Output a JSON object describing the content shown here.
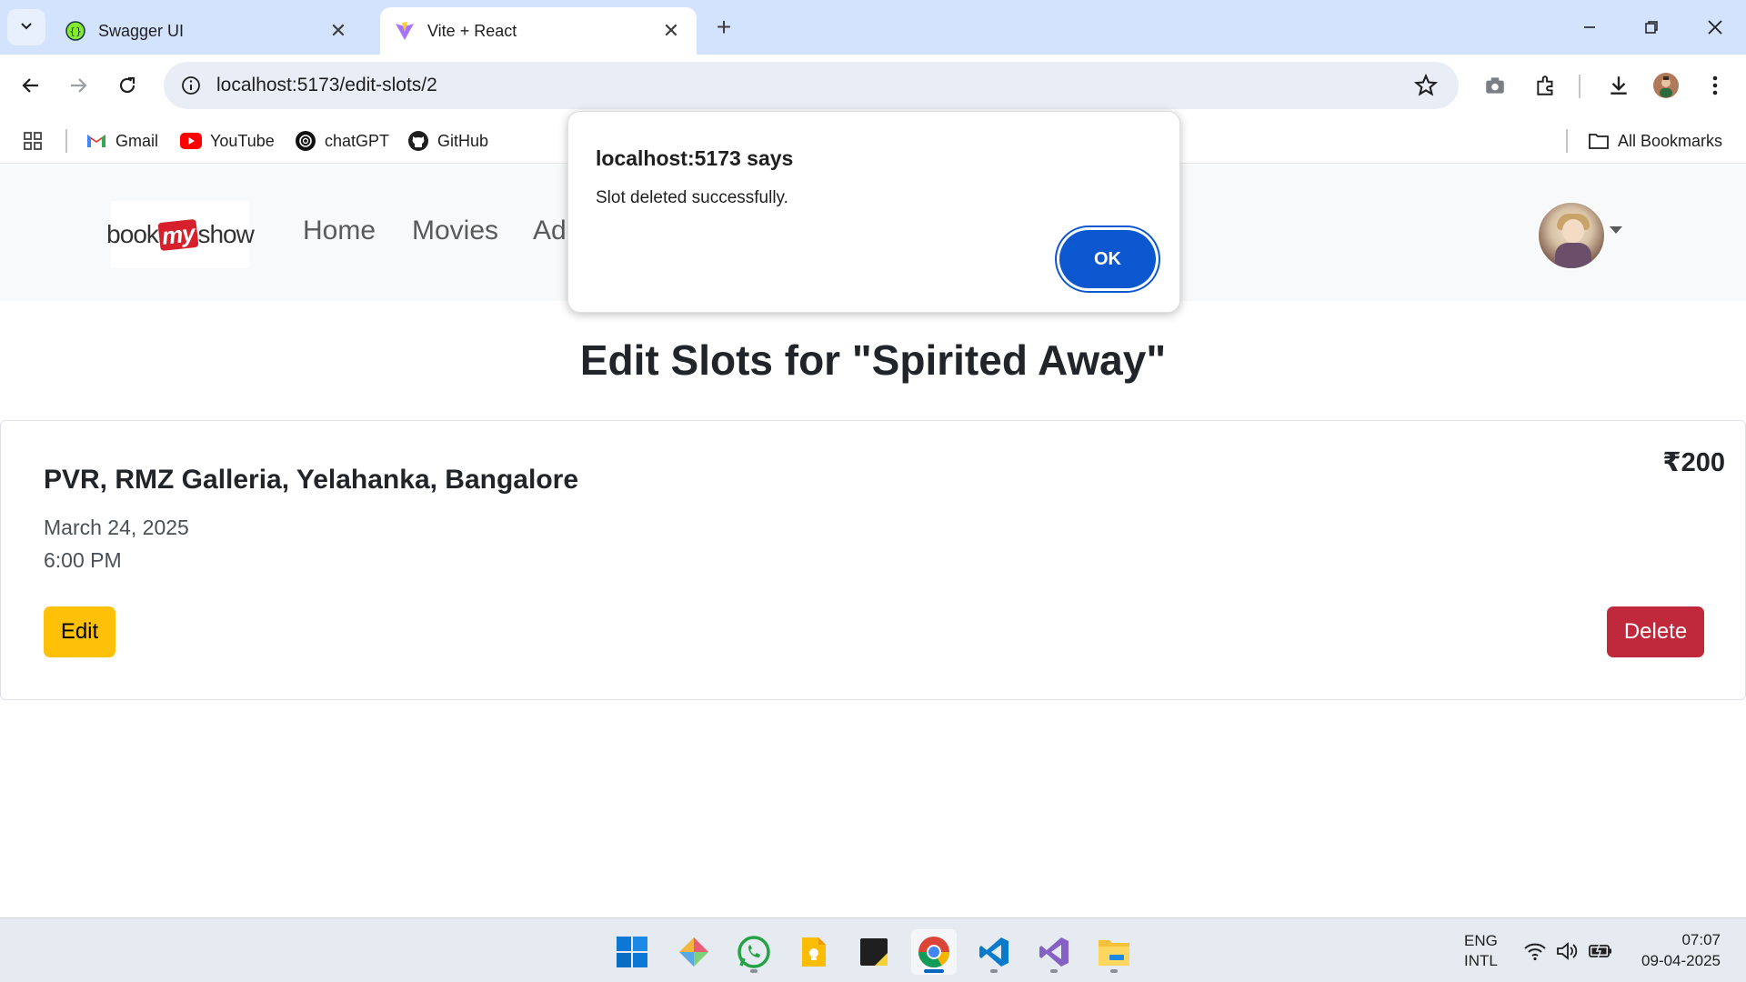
{
  "browser": {
    "tabs": [
      {
        "title": "Swagger UI",
        "icon": "swagger-icon"
      },
      {
        "title": "Vite + React",
        "icon": "vite-icon"
      }
    ],
    "url": "localhost:5173/edit-slots/2",
    "bookmarks": [
      {
        "label": "Gmail",
        "icon": "gmail-icon"
      },
      {
        "label": "YouTube",
        "icon": "youtube-icon"
      },
      {
        "label": "chatGPT",
        "icon": "chatgpt-icon"
      },
      {
        "label": "GitHub",
        "icon": "github-icon"
      }
    ],
    "all_bookmarks": "All Bookmarks"
  },
  "app": {
    "logo": {
      "pre": "book",
      "mid": "my",
      "post": "show"
    },
    "nav": [
      {
        "label": "Home"
      },
      {
        "label": "Movies"
      },
      {
        "label": "Ad"
      }
    ],
    "page_title": "Edit Slots for \"Spirited Away\"",
    "slot": {
      "theatre": "PVR, RMZ Galleria, Yelahanka, Bangalore",
      "price": "₹200",
      "date": "March 24, 2025",
      "time": "6:00 PM",
      "edit_label": "Edit",
      "delete_label": "Delete"
    }
  },
  "dialog": {
    "title": "localhost:5173 says",
    "message": "Slot deleted successfully.",
    "ok_label": "OK"
  },
  "taskbar": {
    "lang_line1": "ENG",
    "lang_line2": "INTL",
    "time": "07:07",
    "date": "09-04-2025"
  },
  "colors": {
    "accent": "#0b57d0",
    "edit_button": "#ffc107",
    "delete_button": "#c0283b",
    "tabstrip": "#d3e3fd"
  }
}
